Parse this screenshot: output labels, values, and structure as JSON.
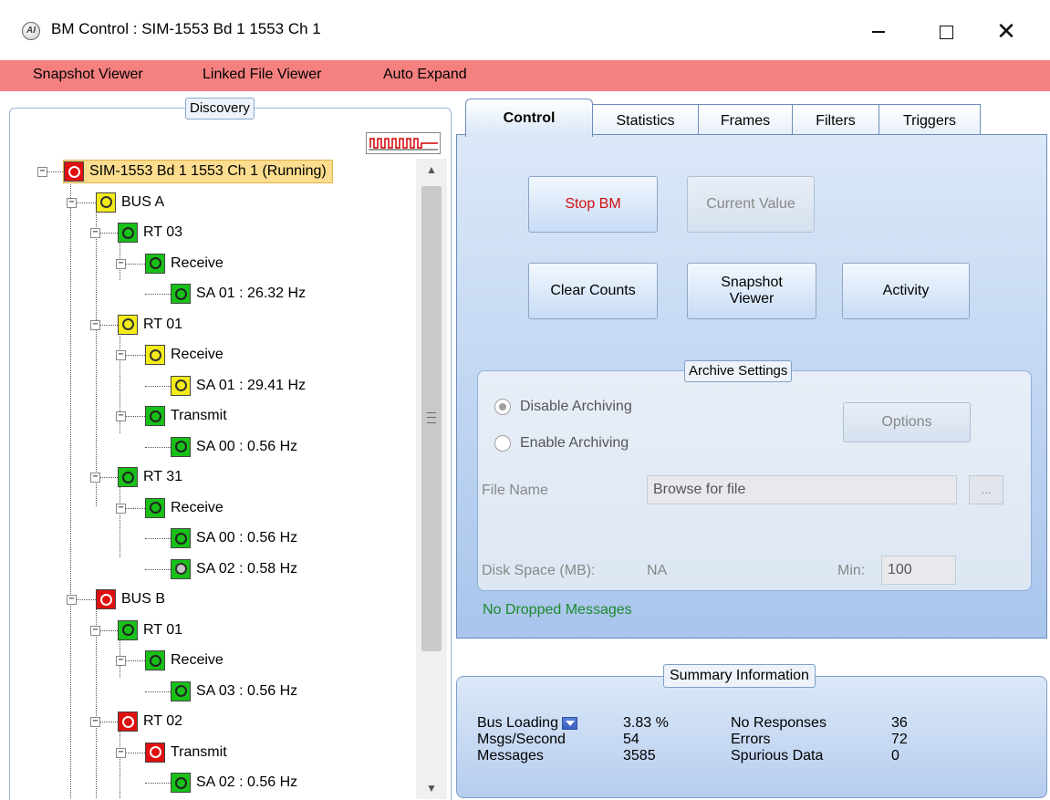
{
  "window": {
    "icon_text": "AI",
    "title": "BM Control : SIM-1553 Bd 1 1553 Ch 1",
    "minimize_icon": "minimize-icon",
    "maximize_icon": "maximize-icon",
    "close_glyph": "✕"
  },
  "menu": {
    "items": [
      "Snapshot Viewer",
      "Linked File Viewer",
      "Auto Expand"
    ],
    "background": "#f58080"
  },
  "discovery": {
    "caption": "Discovery",
    "tree": [
      {
        "label": "SIM-1553 Bd 1 1553 Ch 1 (Running)",
        "status": "red",
        "level": 0
      },
      {
        "label": "BUS A",
        "status": "yellow",
        "level": 1
      },
      {
        "label": "RT 03",
        "status": "green",
        "level": 2
      },
      {
        "label": "Receive",
        "status": "green",
        "level": 3
      },
      {
        "label": "SA 01 : 26.32 Hz",
        "status": "green",
        "level": 4
      },
      {
        "label": "RT 01",
        "status": "yellow",
        "level": 2
      },
      {
        "label": "Receive",
        "status": "yellow",
        "level": 3
      },
      {
        "label": "SA 01 : 29.41 Hz",
        "status": "yellow",
        "level": 4
      },
      {
        "label": "Transmit",
        "status": "green",
        "level": 3
      },
      {
        "label": "SA 00 : 0.56 Hz",
        "status": "green",
        "level": 4
      },
      {
        "label": "RT 31",
        "status": "green",
        "level": 2
      },
      {
        "label": "Receive",
        "status": "green",
        "level": 3
      },
      {
        "label": "SA 00 : 0.56 Hz",
        "status": "green",
        "level": 4
      },
      {
        "label": "SA 02 : 0.58 Hz",
        "status": "green-grey",
        "level": 4
      },
      {
        "label": "BUS B",
        "status": "red",
        "level": 1
      },
      {
        "label": "RT 01",
        "status": "green",
        "level": 2
      },
      {
        "label": "Receive",
        "status": "green",
        "level": 3
      },
      {
        "label": "SA 03 : 0.56 Hz",
        "status": "green",
        "level": 4
      },
      {
        "label": "RT 02",
        "status": "red",
        "level": 2
      },
      {
        "label": "Transmit",
        "status": "red",
        "level": 3
      },
      {
        "label": "SA 02 : 0.56 Hz",
        "status": "green",
        "level": 4
      }
    ]
  },
  "tabs": [
    "Control",
    "Statistics",
    "Frames",
    "Filters",
    "Triggers"
  ],
  "control": {
    "stop_bm": "Stop BM",
    "current_value": "Current Value",
    "clear_counts": "Clear Counts",
    "snapshot_viewer_line1": "Snapshot",
    "snapshot_viewer_line2": "Viewer",
    "activity": "Activity",
    "archive": {
      "caption": "Archive Settings",
      "disable_archiving": "Disable Archiving",
      "enable_archiving": "Enable Archiving",
      "options": "Options",
      "file_name_label": "File Name",
      "file_name_value": "Browse for file",
      "browse_button": "...",
      "disk_space_label": "Disk Space (MB):",
      "disk_space_value": "NA",
      "min_label": "Min:",
      "min_value": "100"
    },
    "dropped_status": "No Dropped Messages"
  },
  "summary": {
    "caption": "Summary Information",
    "bus_loading_label": "Bus Loading",
    "bus_loading_value": "3.83 %",
    "msgs_per_second_label": "Msgs/Second",
    "msgs_per_second_value": "54",
    "messages_label": "Messages",
    "messages_value": "3585",
    "no_responses_label": "No Responses",
    "no_responses_value": "36",
    "errors_label": "Errors",
    "errors_value": "72",
    "spurious_label": "Spurious Data",
    "spurious_value": "0"
  },
  "colors": {
    "status_red": "#e01010",
    "status_yellow": "#f4ec18",
    "status_green": "#18c018",
    "dropped_text": "#1b8a2a",
    "stop_text": "#d01010"
  }
}
